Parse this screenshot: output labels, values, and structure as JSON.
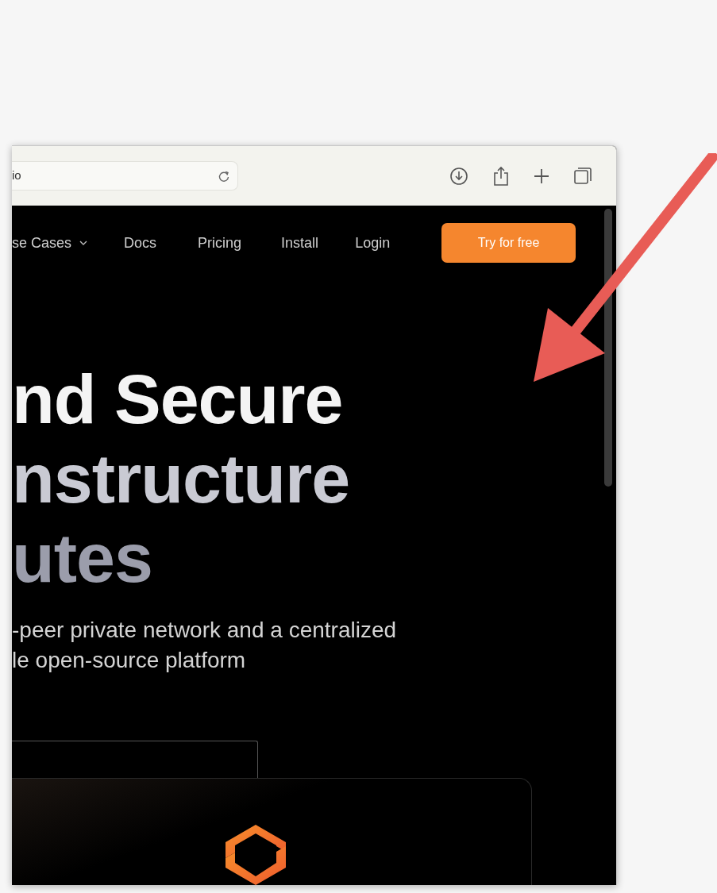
{
  "browser": {
    "address": "io"
  },
  "nav": {
    "items": [
      {
        "label": "se Cases",
        "dropdown": true
      },
      {
        "label": "Docs",
        "dropdown": false
      },
      {
        "label": "Pricing",
        "dropdown": false
      },
      {
        "label": "Install",
        "dropdown": false
      },
      {
        "label": "Login",
        "dropdown": false
      }
    ],
    "cta": "Try for free"
  },
  "hero": {
    "headline": [
      "nd Secure",
      "nstructure",
      "utes"
    ],
    "subtitle": [
      "-peer private network and a centralized",
      "le open-source platform"
    ]
  }
}
